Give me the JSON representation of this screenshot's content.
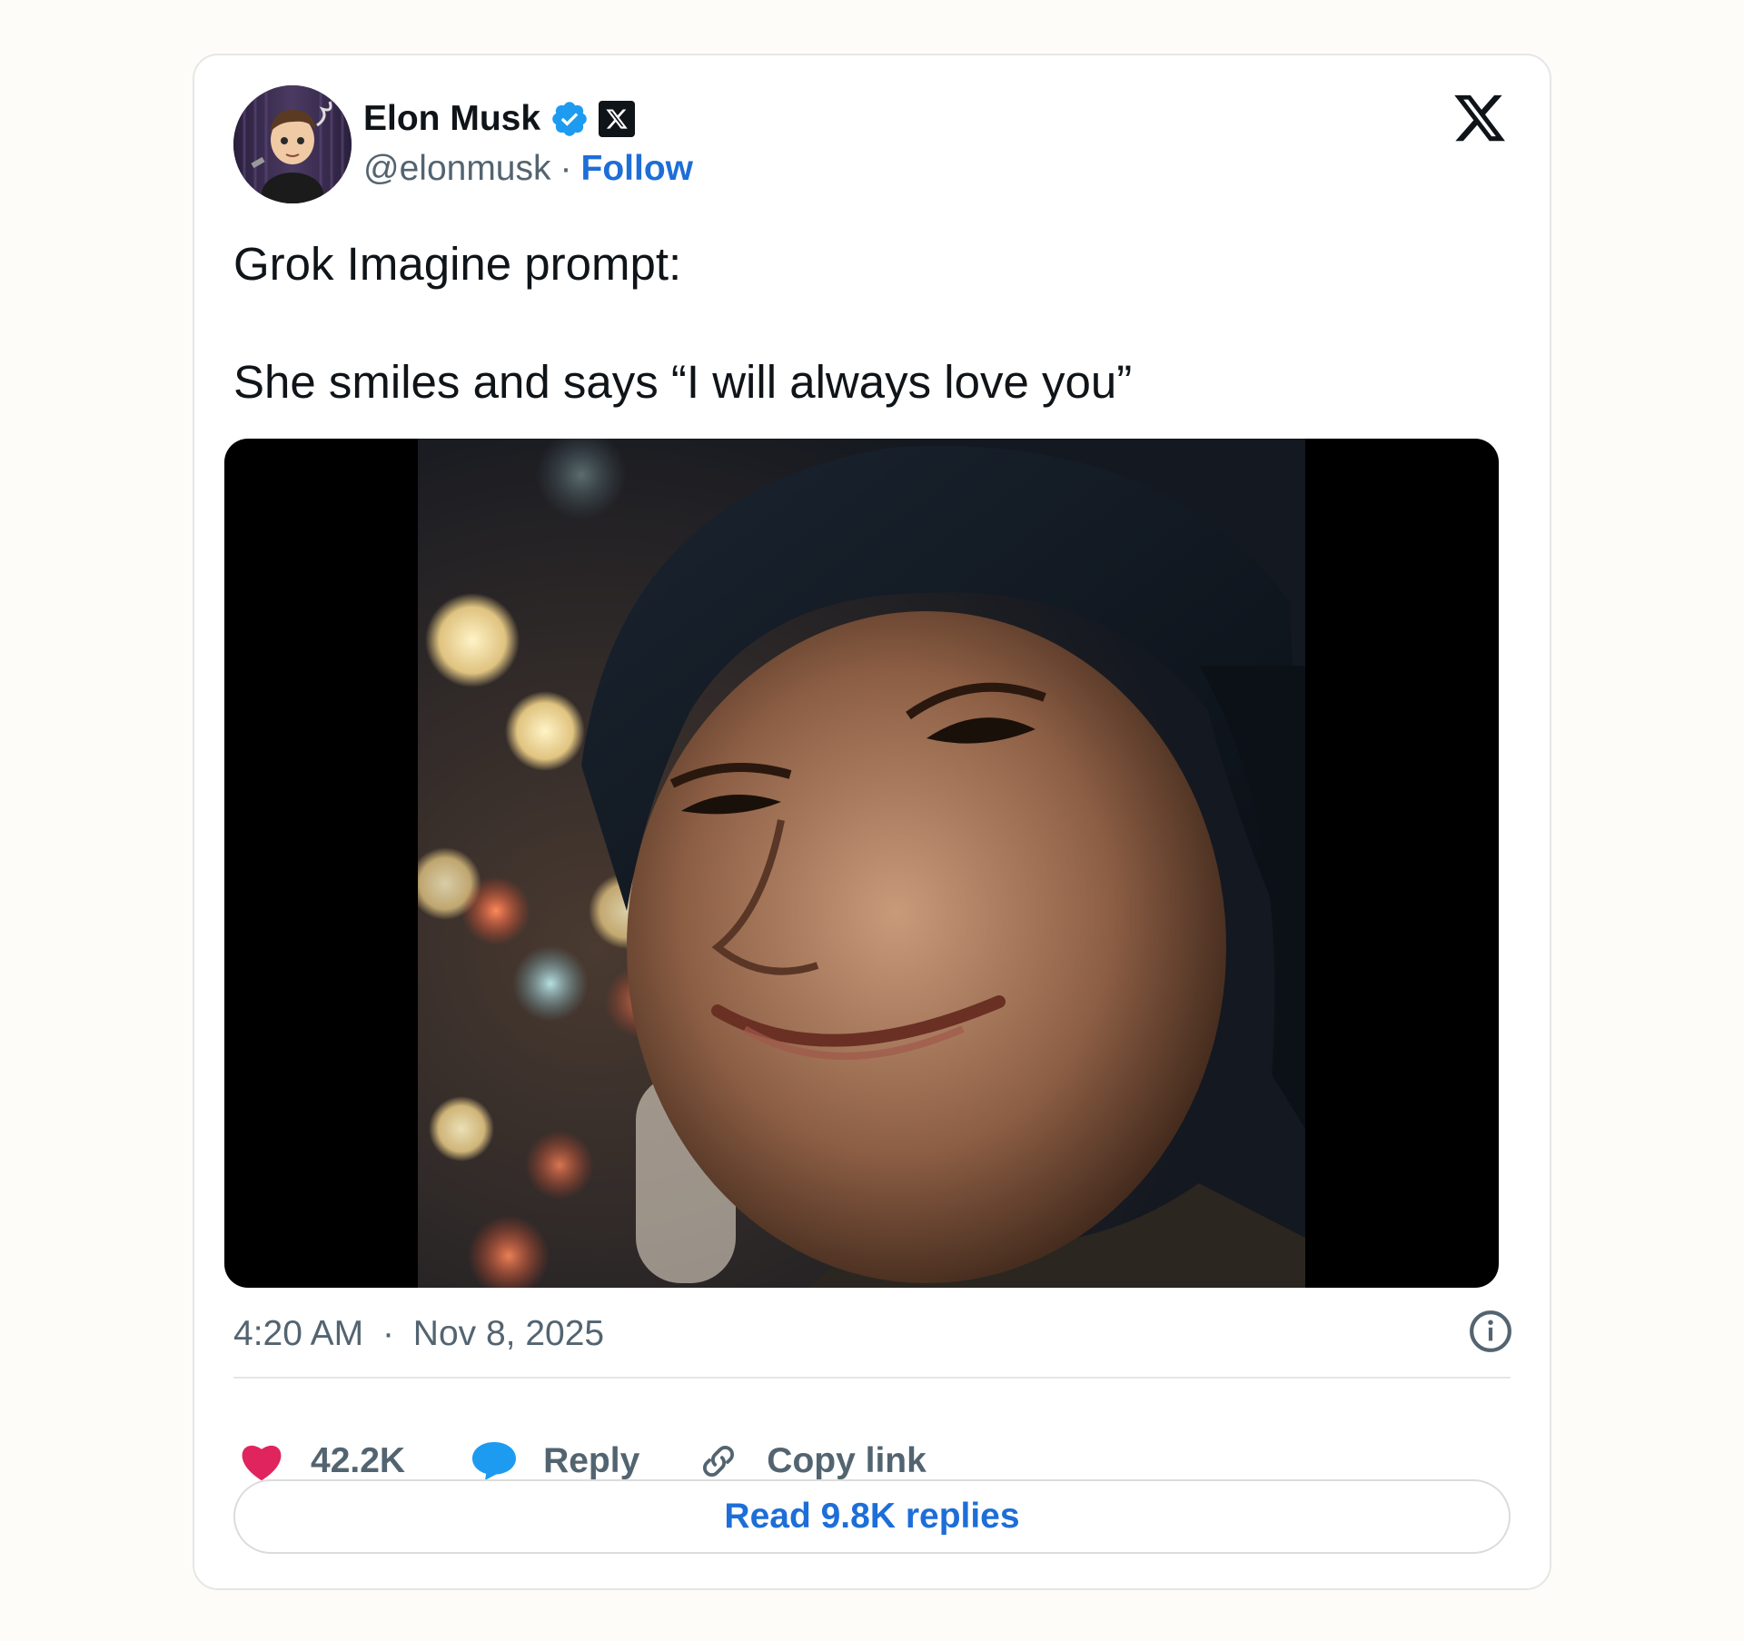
{
  "author": {
    "display_name": "Elon Musk",
    "handle": "@elonmusk",
    "separator": "·",
    "follow_label": "Follow",
    "verified_icon": "verified-badge-icon",
    "affiliate_icon": "x-affiliate-badge-icon"
  },
  "tweet": {
    "paragraphs": [
      "Grok Imagine prompt:",
      "She smiles and says “I will always love you”"
    ]
  },
  "media": {
    "kind": "video"
  },
  "meta": {
    "time": "4:20 AM",
    "separator": "·",
    "date": "Nov 8, 2025"
  },
  "actions": {
    "likes": "42.2K",
    "reply_label": "Reply",
    "copy_link_label": "Copy link"
  },
  "read_replies_label": "Read 9.8K replies",
  "colors": {
    "accent_blue": "#1d6ed8",
    "like_pink": "#e0245e",
    "reply_blue": "#1d9bf0",
    "text_primary": "#0f1419",
    "text_secondary": "#536471",
    "page_background": "#fdfcf8"
  }
}
